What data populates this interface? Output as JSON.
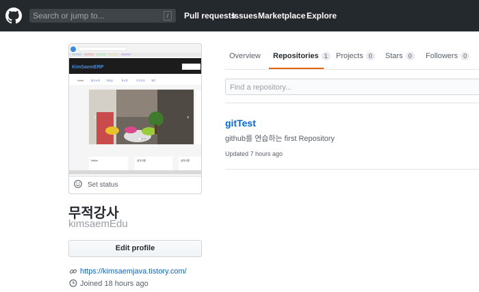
{
  "header": {
    "search_placeholder": "Search or jump to...",
    "search_shortcut": "/",
    "nav": [
      "Pull requests",
      "Issues",
      "Marketplace",
      "Explore"
    ]
  },
  "profile": {
    "avatar": {
      "brand": "KimSaemERP",
      "menu": [
        "Home",
        "회사소개",
        "자료실",
        "게시판",
        "인사관리",
        "재무"
      ],
      "cards": [
        "Notice",
        "공지사항",
        "공지사항"
      ]
    },
    "set_status": "Set status",
    "fullname": "무적강사",
    "username": "kimsaemEdu",
    "edit_profile": "Edit profile",
    "blog_url": "https://kimsaemjava.tistory.com/",
    "joined": "Joined 18 hours ago"
  },
  "tabs": [
    {
      "label": "Overview",
      "count": null
    },
    {
      "label": "Repositories",
      "count": "1"
    },
    {
      "label": "Projects",
      "count": "0"
    },
    {
      "label": "Stars",
      "count": "0"
    },
    {
      "label": "Followers",
      "count": "0"
    }
  ],
  "repo_filter_placeholder": "Find a repository...",
  "repos": [
    {
      "name": "gitTest",
      "description": "github를 연습하는 first Repository",
      "updated": "Updated 7 hours ago"
    }
  ],
  "colors": {
    "header_bg": "#24292e",
    "link": "#0366d6",
    "tab_accent": "#e36209"
  }
}
